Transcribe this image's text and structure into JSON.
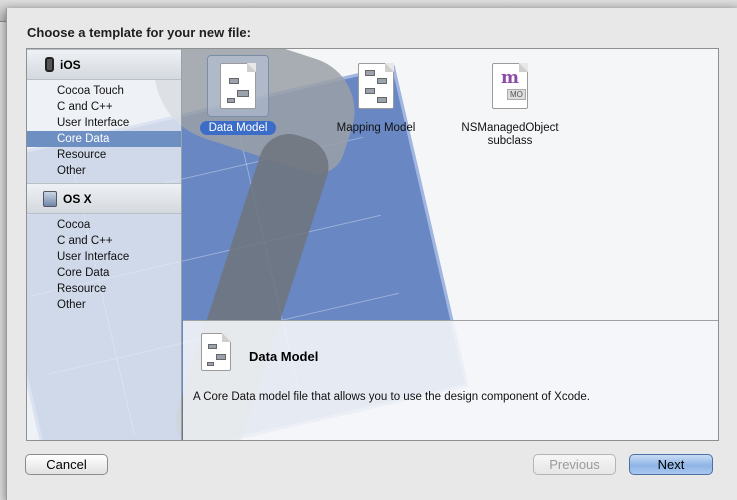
{
  "sheet": {
    "title": "Choose a template for your new file:"
  },
  "sidebar": {
    "groups": [
      {
        "name": "iOS",
        "items": [
          "Cocoa Touch",
          "C and C++",
          "User Interface",
          "Core Data",
          "Resource",
          "Other"
        ],
        "selected": "Core Data"
      },
      {
        "name": "OS X",
        "items": [
          "Cocoa",
          "C and C++",
          "User Interface",
          "Core Data",
          "Resource",
          "Other"
        ]
      }
    ]
  },
  "templates": [
    {
      "label": "Data Model",
      "icon": "data-model-icon",
      "selected": true
    },
    {
      "label": "Mapping Model",
      "icon": "mapping-model-icon"
    },
    {
      "label_line1": "NSManagedObject",
      "label_line2": "subclass",
      "icon": "managed-object-icon",
      "icon_glyph": "m",
      "icon_tag": "MO"
    }
  ],
  "description": {
    "title": "Data Model",
    "text": "A Core Data model file that allows you to use the design component of Xcode."
  },
  "buttons": {
    "cancel": "Cancel",
    "previous": "Previous",
    "next": "Next"
  },
  "colors": {
    "selection": "#6d8fc2",
    "selected_label": "#3b6cc8",
    "accent_button": "#8fb4e6"
  }
}
